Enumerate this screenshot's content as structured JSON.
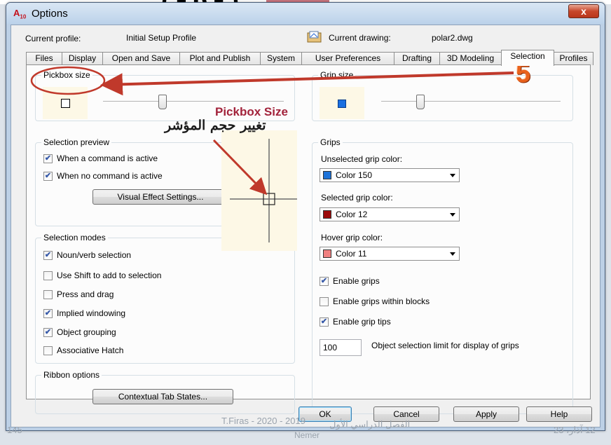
{
  "window": {
    "title": "Options",
    "app_icon": "autocad-icon",
    "close_label": "x"
  },
  "profile": {
    "current_profile_label": "Current profile:",
    "current_profile_value": "Initial Setup Profile",
    "current_drawing_label": "Current drawing:",
    "current_drawing_value": "polar2.dwg"
  },
  "tabs": [
    {
      "label": "Files"
    },
    {
      "label": "Display"
    },
    {
      "label": "Open and Save"
    },
    {
      "label": "Plot and Publish"
    },
    {
      "label": "System"
    },
    {
      "label": "User Preferences"
    },
    {
      "label": "Drafting"
    },
    {
      "label": "3D Modeling"
    },
    {
      "label": "Selection",
      "active": true
    },
    {
      "label": "Profiles"
    }
  ],
  "pickbox": {
    "title": "Pickbox size",
    "level": 0.33
  },
  "grip_size": {
    "title": "Grip size",
    "level": 0.22,
    "color": "#1a6fe0"
  },
  "selection_preview": {
    "title": "Selection preview",
    "items": [
      {
        "label": "When a command is active",
        "checked": true
      },
      {
        "label": "When no command is active",
        "checked": true
      }
    ],
    "button_label": "Visual Effect Settings..."
  },
  "selection_modes": {
    "title": "Selection modes",
    "items": [
      {
        "label": "Noun/verb selection",
        "checked": true
      },
      {
        "label": "Use Shift to add to selection",
        "checked": false
      },
      {
        "label": "Press and drag",
        "checked": false
      },
      {
        "label": "Implied windowing",
        "checked": true
      },
      {
        "label": "Object grouping",
        "checked": true
      },
      {
        "label": "Associative Hatch",
        "checked": false
      }
    ]
  },
  "ribbon_options": {
    "title": "Ribbon options",
    "button_label": "Contextual Tab States..."
  },
  "grips": {
    "title": "Grips",
    "unselected_label": "Unselected grip color:",
    "unselected_value": "Color 150",
    "unselected_color": "#1e73d8",
    "selected_label": "Selected grip color:",
    "selected_value": "Color 12",
    "selected_color": "#9c0a0a",
    "hover_label": "Hover grip color:",
    "hover_value": "Color 11",
    "hover_color": "#f08080",
    "checks": [
      {
        "label": "Enable grips",
        "checked": true
      },
      {
        "label": "Enable grips within blocks",
        "checked": false
      },
      {
        "label": "Enable grip tips",
        "checked": true
      }
    ],
    "limit_value": "100",
    "limit_label": "Object selection limit for display of grips"
  },
  "buttons": {
    "ok": "OK",
    "cancel": "Cancel",
    "apply": "Apply",
    "help": "Help"
  },
  "annotation": {
    "english": "Pickbox Size",
    "arabic": "تغيير حجم المؤشر",
    "step_number": "5",
    "accent_color": "#c0392b"
  },
  "slide_footer": {
    "page_number": "145",
    "author": "T.Firas - 2020 - 2019",
    "arabic_term": "الفصل الدراسي الأول",
    "name": "Nemer",
    "date": "12 آذار، 23"
  }
}
